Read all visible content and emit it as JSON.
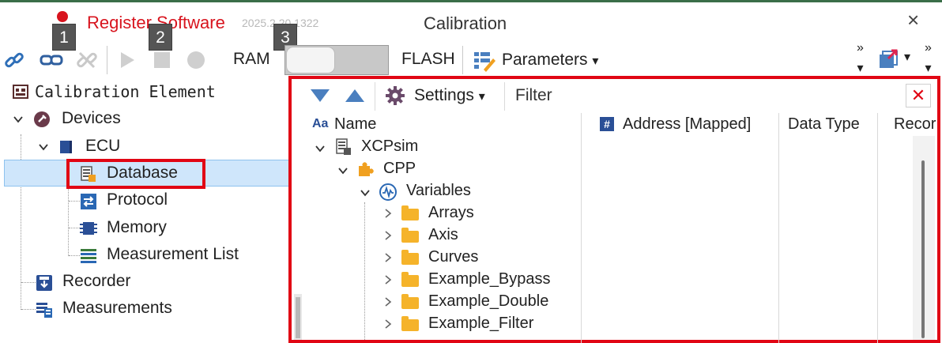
{
  "window": {
    "register_label": "Register Software",
    "version": "2025.2.20.1322",
    "title": "Calibration",
    "close_glyph": "×"
  },
  "badges": [
    "1",
    "2",
    "3"
  ],
  "toolbar": {
    "ram_label": "RAM",
    "flash_label": "FLASH",
    "parameters_label": "Parameters",
    "dropdown_glyph": "▾",
    "overflow_glyph": "»",
    "icons": [
      "link-icon",
      "connect-icon",
      "disconnect-icon",
      "play-icon",
      "stop-icon",
      "record-icon",
      "parameters-icon",
      "export-icon"
    ]
  },
  "tree": {
    "root": "Calibration Element",
    "devices": "Devices",
    "ecu": "ECU",
    "database": "Database",
    "protocol": "Protocol",
    "memory": "Memory",
    "measurement_list": "Measurement List",
    "recorder": "Recorder",
    "measurements": "Measurements"
  },
  "panel": {
    "settings_label": "Settings",
    "filter_placeholder": "Filter",
    "close_glyph": "✕",
    "columns": {
      "name": "Name",
      "address": "Address [Mapped]",
      "data_type": "Data Type",
      "record": "Recor"
    },
    "column_icons": {
      "name": "Aa",
      "address": "#"
    },
    "rows": {
      "xcpsim": "XCPsim",
      "cpp": "CPP",
      "variables": "Variables",
      "folders": [
        "Arrays",
        "Axis",
        "Curves",
        "Example_Bypass",
        "Example_Double",
        "Example_Filter"
      ]
    }
  },
  "colors": {
    "accent_red": "#e10614",
    "selection": "#cfe6fb",
    "folder": "#f5b32a",
    "blue_icon": "#2a68b4"
  }
}
